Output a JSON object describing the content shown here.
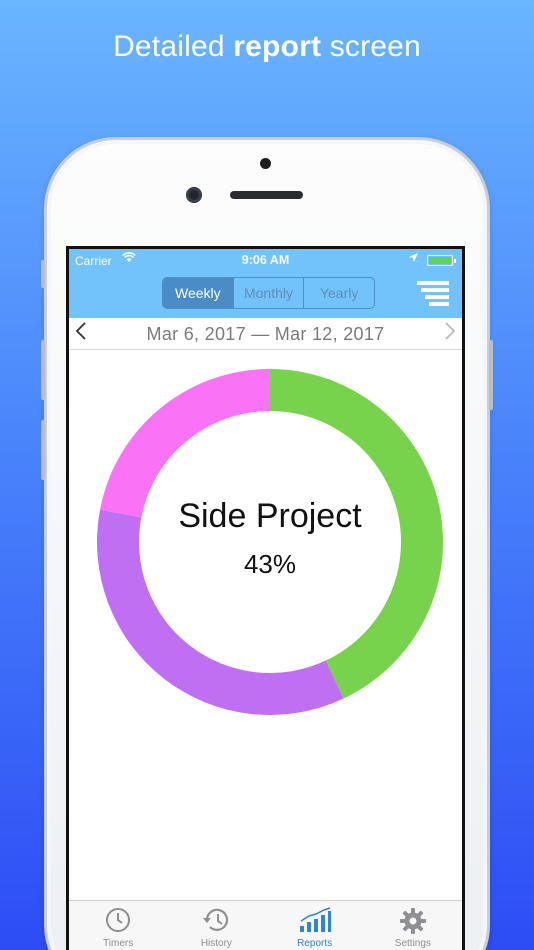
{
  "headline": {
    "before": "Detailed ",
    "bold": "report",
    "after": " screen"
  },
  "statusbar": {
    "carrier": "Carrier",
    "time": "9:06 AM"
  },
  "segments": [
    {
      "label": "Weekly",
      "active": true
    },
    {
      "label": "Monthly",
      "active": false
    },
    {
      "label": "Yearly",
      "active": false
    }
  ],
  "date_range": "Mar 6, 2017  —  Mar 12, 2017",
  "chart": {
    "type": "pie",
    "center_title": "Side Project",
    "center_value": "43%",
    "slices": [
      {
        "value": 43,
        "color": "#78d34c"
      },
      {
        "value": 35,
        "color": "#c06ef2"
      },
      {
        "value": 22,
        "color": "#fa73f6"
      }
    ]
  },
  "tabs": [
    {
      "label": "Timers",
      "icon": "clock-icon",
      "active": false
    },
    {
      "label": "History",
      "icon": "history-icon",
      "active": false
    },
    {
      "label": "Reports",
      "icon": "bar-chart-icon",
      "active": true
    },
    {
      "label": "Settings",
      "icon": "gear-icon",
      "active": false
    }
  ]
}
